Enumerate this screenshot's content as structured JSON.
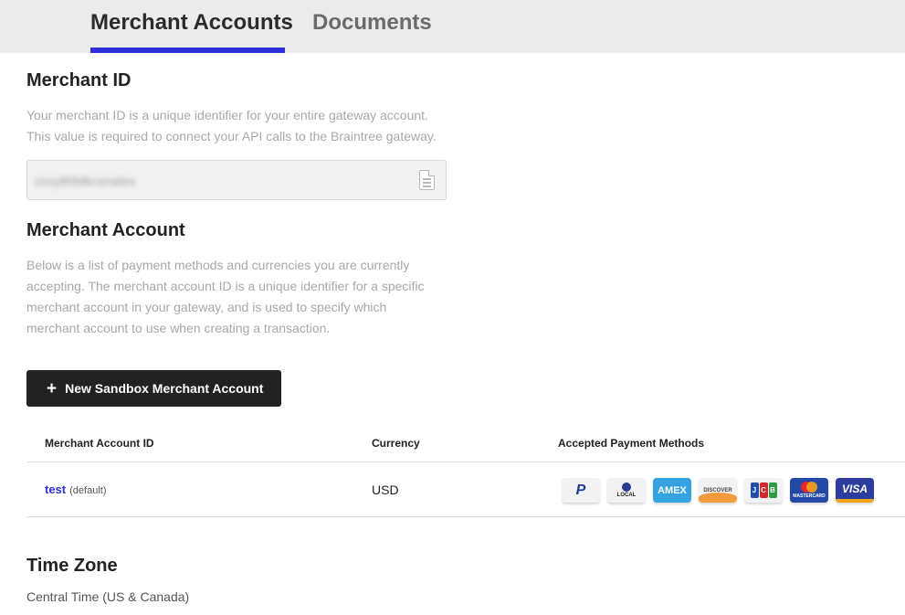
{
  "tabs": [
    {
      "label": "Merchant Accounts",
      "active": true
    },
    {
      "label": "Documents",
      "active": false
    }
  ],
  "merchant_id": {
    "title": "Merchant ID",
    "description": [
      "Your merchant ID is a unique identifier for your entire gateway account.",
      "This value is required to connect your API calls to the Braintree gateway."
    ],
    "value": "zxvy8t9dkcsnatex",
    "copy_icon": "copy-icon"
  },
  "merchant_account": {
    "title": "Merchant Account",
    "description": [
      "Below is a list of payment methods and currencies you are currently",
      "accepting. The merchant account ID is a unique identifier for a specific",
      "merchant account in your gateway, and is used to specify which",
      "merchant account to use when creating a transaction."
    ],
    "new_button_label": "New Sandbox Merchant Account",
    "table": {
      "headers": [
        "Merchant Account ID",
        "Currency",
        "Accepted Payment Methods"
      ],
      "rows": [
        {
          "id": "test",
          "tag": "(default)",
          "currency": "USD",
          "payment_methods": [
            "P",
            "LOCAL",
            "AMEX",
            "DISCOVER",
            "J",
            "C",
            "B",
            "MASTERCARD",
            "VISA"
          ]
        }
      ]
    }
  },
  "time_zone": {
    "title": "Time Zone",
    "value": "Central Time (US & Canada)"
  },
  "colors": {
    "accent": "#2d2fd9",
    "button_bg": "#222222",
    "tab_bar_bg": "#ebebeb",
    "amex": "#35a3e0",
    "visa": "#2a3d9c",
    "mastercard": "#2149a5"
  }
}
